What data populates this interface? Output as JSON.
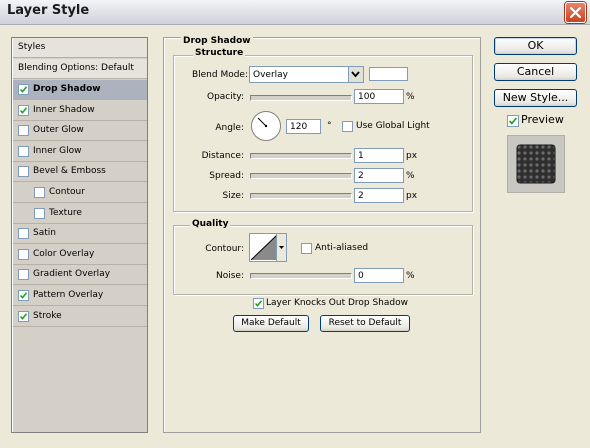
{
  "window": {
    "title": "Layer Style"
  },
  "styles_panel": {
    "header": "Styles",
    "blending_options": "Blending Options: Default",
    "items": [
      {
        "label": "Drop Shadow",
        "checked": true,
        "selected": true,
        "indent": false
      },
      {
        "label": "Inner Shadow",
        "checked": true,
        "selected": false,
        "indent": false
      },
      {
        "label": "Outer Glow",
        "checked": false,
        "selected": false,
        "indent": false
      },
      {
        "label": "Inner Glow",
        "checked": false,
        "selected": false,
        "indent": false
      },
      {
        "label": "Bevel & Emboss",
        "checked": false,
        "selected": false,
        "indent": false
      },
      {
        "label": "Contour",
        "checked": false,
        "selected": false,
        "indent": true
      },
      {
        "label": "Texture",
        "checked": false,
        "selected": false,
        "indent": true
      },
      {
        "label": "Satin",
        "checked": false,
        "selected": false,
        "indent": false
      },
      {
        "label": "Color Overlay",
        "checked": false,
        "selected": false,
        "indent": false
      },
      {
        "label": "Gradient Overlay",
        "checked": false,
        "selected": false,
        "indent": false
      },
      {
        "label": "Pattern Overlay",
        "checked": true,
        "selected": false,
        "indent": false
      },
      {
        "label": "Stroke",
        "checked": true,
        "selected": false,
        "indent": false
      }
    ]
  },
  "drop_shadow": {
    "section_title": "Drop Shadow",
    "structure": {
      "title": "Structure",
      "blend_mode_label": "Blend Mode:",
      "blend_mode_value": "Overlay",
      "opacity_label": "Opacity:",
      "opacity_value": "100",
      "opacity_unit": "%",
      "opacity_fraction": 1.0,
      "angle_label": "Angle:",
      "angle_value": "120",
      "angle_unit": "°",
      "use_global_light_label": "Use Global Light",
      "use_global_light_checked": false,
      "distance_label": "Distance:",
      "distance_value": "1",
      "distance_unit": "px",
      "spread_label": "Spread:",
      "spread_value": "2",
      "spread_unit": "%",
      "size_label": "Size:",
      "size_value": "2",
      "size_unit": "px"
    },
    "quality": {
      "title": "Quality",
      "contour_label": "Contour:",
      "anti_aliased_label": "Anti-aliased",
      "anti_aliased_checked": false,
      "noise_label": "Noise:",
      "noise_value": "0",
      "noise_unit": "%"
    },
    "knocks_out_label": "Layer Knocks Out Drop Shadow",
    "knocks_out_checked": true,
    "make_default_label": "Make Default",
    "reset_default_label": "Reset to Default"
  },
  "buttons": {
    "ok": "OK",
    "cancel": "Cancel",
    "new_style": "New Style...",
    "preview_label": "Preview",
    "preview_checked": true
  },
  "icons": [
    "close-icon",
    "checkmark-icon",
    "dropdown-arrow-icon",
    "angle-dial-icon",
    "contour-curve-icon",
    "slider-thumb-icon"
  ],
  "colors": {
    "selected_row": "#ADB3BE",
    "close_button": "#C94220",
    "dialog_bg": "#ECE9D8",
    "panel_bg": "#D4D0C8"
  }
}
